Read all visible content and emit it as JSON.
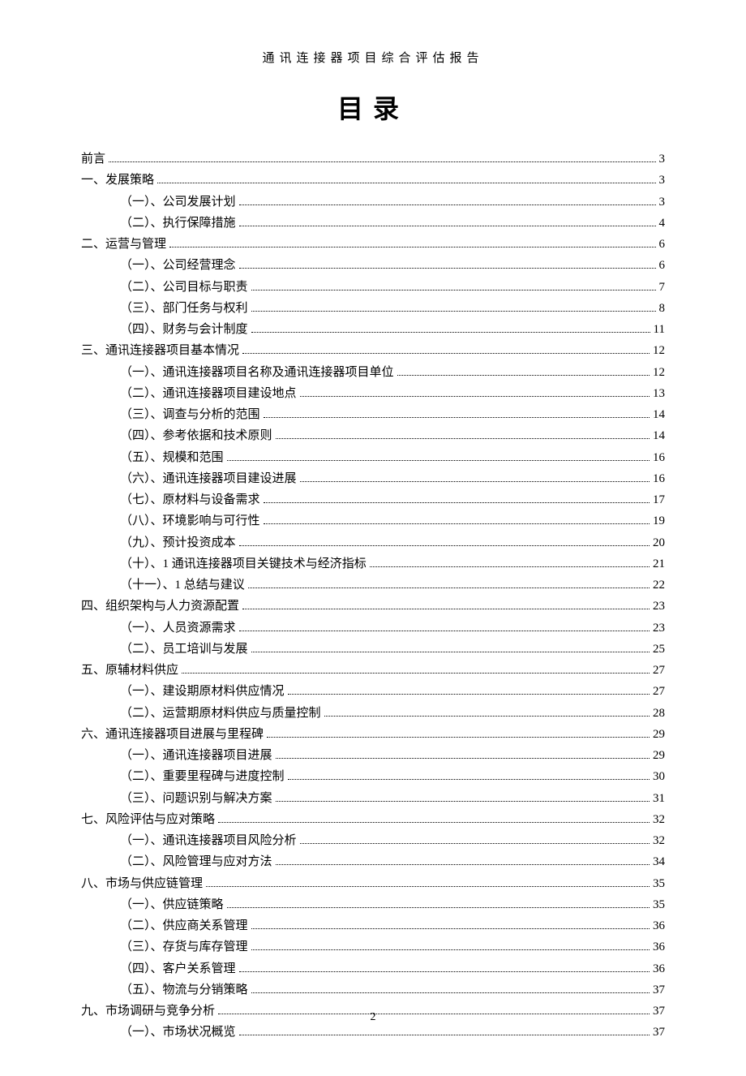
{
  "header": "通讯连接器项目综合评估报告",
  "title": "目录",
  "page_number": "2",
  "toc": [
    {
      "level": 0,
      "label": "前言",
      "page": "3"
    },
    {
      "level": 0,
      "label": "一、发展策略",
      "page": "3"
    },
    {
      "level": 1,
      "label": "（一）、公司发展计划",
      "page": "3"
    },
    {
      "level": 1,
      "label": "（二）、执行保障措施",
      "page": "4"
    },
    {
      "level": 0,
      "label": "二、运营与管理",
      "page": "6"
    },
    {
      "level": 1,
      "label": "（一）、公司经营理念",
      "page": "6"
    },
    {
      "level": 1,
      "label": "（二）、公司目标与职责",
      "page": "7"
    },
    {
      "level": 1,
      "label": "（三）、部门任务与权利",
      "page": "8"
    },
    {
      "level": 1,
      "label": "（四）、财务与会计制度",
      "page": "11"
    },
    {
      "level": 0,
      "label": "三、通讯连接器项目基本情况",
      "page": "12"
    },
    {
      "level": 1,
      "label": "（一）、通讯连接器项目名称及通讯连接器项目单位",
      "page": "12"
    },
    {
      "level": 1,
      "label": "（二）、通讯连接器项目建设地点",
      "page": "13"
    },
    {
      "level": 1,
      "label": "（三）、调查与分析的范围",
      "page": "14"
    },
    {
      "level": 1,
      "label": "（四）、参考依据和技术原则",
      "page": "14"
    },
    {
      "level": 1,
      "label": "（五）、规模和范围",
      "page": "16"
    },
    {
      "level": 1,
      "label": "（六）、通讯连接器项目建设进展",
      "page": "16"
    },
    {
      "level": 1,
      "label": "（七）、原材料与设备需求",
      "page": "17"
    },
    {
      "level": 1,
      "label": "（八）、环境影响与可行性",
      "page": "19"
    },
    {
      "level": 1,
      "label": "（九）、预计投资成本",
      "page": "20"
    },
    {
      "level": 1,
      "label": "（十）、1 通讯连接器项目关键技术与经济指标",
      "page": "21"
    },
    {
      "level": 1,
      "label": "（十一）、1 总结与建议",
      "page": "22"
    },
    {
      "level": 0,
      "label": "四、组织架构与人力资源配置",
      "page": "23"
    },
    {
      "level": 1,
      "label": "（一）、人员资源需求",
      "page": "23"
    },
    {
      "level": 1,
      "label": "（二）、员工培训与发展",
      "page": "25"
    },
    {
      "level": 0,
      "label": "五、原辅材料供应",
      "page": "27"
    },
    {
      "level": 1,
      "label": "（一）、建设期原材料供应情况",
      "page": "27"
    },
    {
      "level": 1,
      "label": "（二）、运营期原材料供应与质量控制",
      "page": "28"
    },
    {
      "level": 0,
      "label": "六、通讯连接器项目进展与里程碑",
      "page": "29"
    },
    {
      "level": 1,
      "label": "（一）、通讯连接器项目进展",
      "page": "29"
    },
    {
      "level": 1,
      "label": "（二）、重要里程碑与进度控制",
      "page": "30"
    },
    {
      "level": 1,
      "label": "（三）、问题识别与解决方案",
      "page": "31"
    },
    {
      "level": 0,
      "label": "七、风险评估与应对策略",
      "page": "32"
    },
    {
      "level": 1,
      "label": "（一）、通讯连接器项目风险分析",
      "page": "32"
    },
    {
      "level": 1,
      "label": "（二）、风险管理与应对方法",
      "page": "34"
    },
    {
      "level": 0,
      "label": "八、市场与供应链管理",
      "page": "35"
    },
    {
      "level": 1,
      "label": "（一）、供应链策略",
      "page": "35"
    },
    {
      "level": 1,
      "label": "（二）、供应商关系管理",
      "page": "36"
    },
    {
      "level": 1,
      "label": "（三）、存货与库存管理",
      "page": "36"
    },
    {
      "level": 1,
      "label": "（四）、客户关系管理",
      "page": "36"
    },
    {
      "level": 1,
      "label": "（五）、物流与分销策略",
      "page": "37"
    },
    {
      "level": 0,
      "label": "九、市场调研与竞争分析",
      "page": "37"
    },
    {
      "level": 1,
      "label": "（一）、市场状况概览",
      "page": "37"
    }
  ]
}
